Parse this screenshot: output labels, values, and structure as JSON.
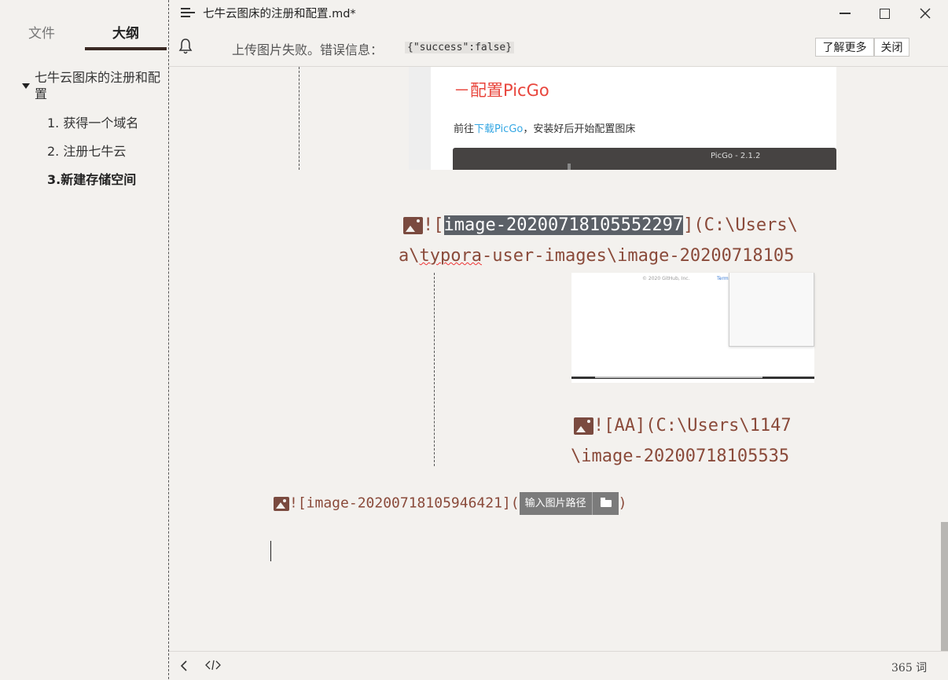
{
  "window": {
    "title": "七牛云图床的注册和配置.md*"
  },
  "sidebar": {
    "tabs": [
      {
        "label": "文件"
      },
      {
        "label": "大纲"
      }
    ],
    "outline": {
      "root": "七牛云图床的注册和配置",
      "items": [
        {
          "label": "1. 获得一个域名"
        },
        {
          "label": "2. 注册七牛云"
        },
        {
          "label": "3.新建存储空间"
        }
      ]
    }
  },
  "notification": {
    "message": "上传图片失败。错误信息：",
    "code": "{\"success\":false}",
    "learn_more": "了解更多",
    "close": "关闭"
  },
  "editor": {
    "embedded_1": {
      "heading": "－配置PicGo",
      "text_prefix": "前往",
      "text_link": "下载PicGo",
      "text_suffix": "，安装好后开始配置图床",
      "bar_title": "PicGo - 2.1.2"
    },
    "image_line_1": {
      "open": "![",
      "alt_selected": "image-20200718105552297",
      "rest": "](C:\\Users\\",
      "line2_a": "a\\",
      "line2_spell": "typora",
      "line2_b": "-user-images\\image-20200718105"
    },
    "embedded_2": {
      "copyright": "© 2020 GitHub, Inc.",
      "terms": "Terms"
    },
    "image_line_2": {
      "line1": "![AA](C:\\Users\\1147",
      "line2": "\\image-20200718105535"
    },
    "image_line_3": {
      "code": "![image-20200718105946421](",
      "path_placeholder": "输入图片路径",
      "close": ")"
    }
  },
  "status": {
    "word_count": "365 词"
  }
}
